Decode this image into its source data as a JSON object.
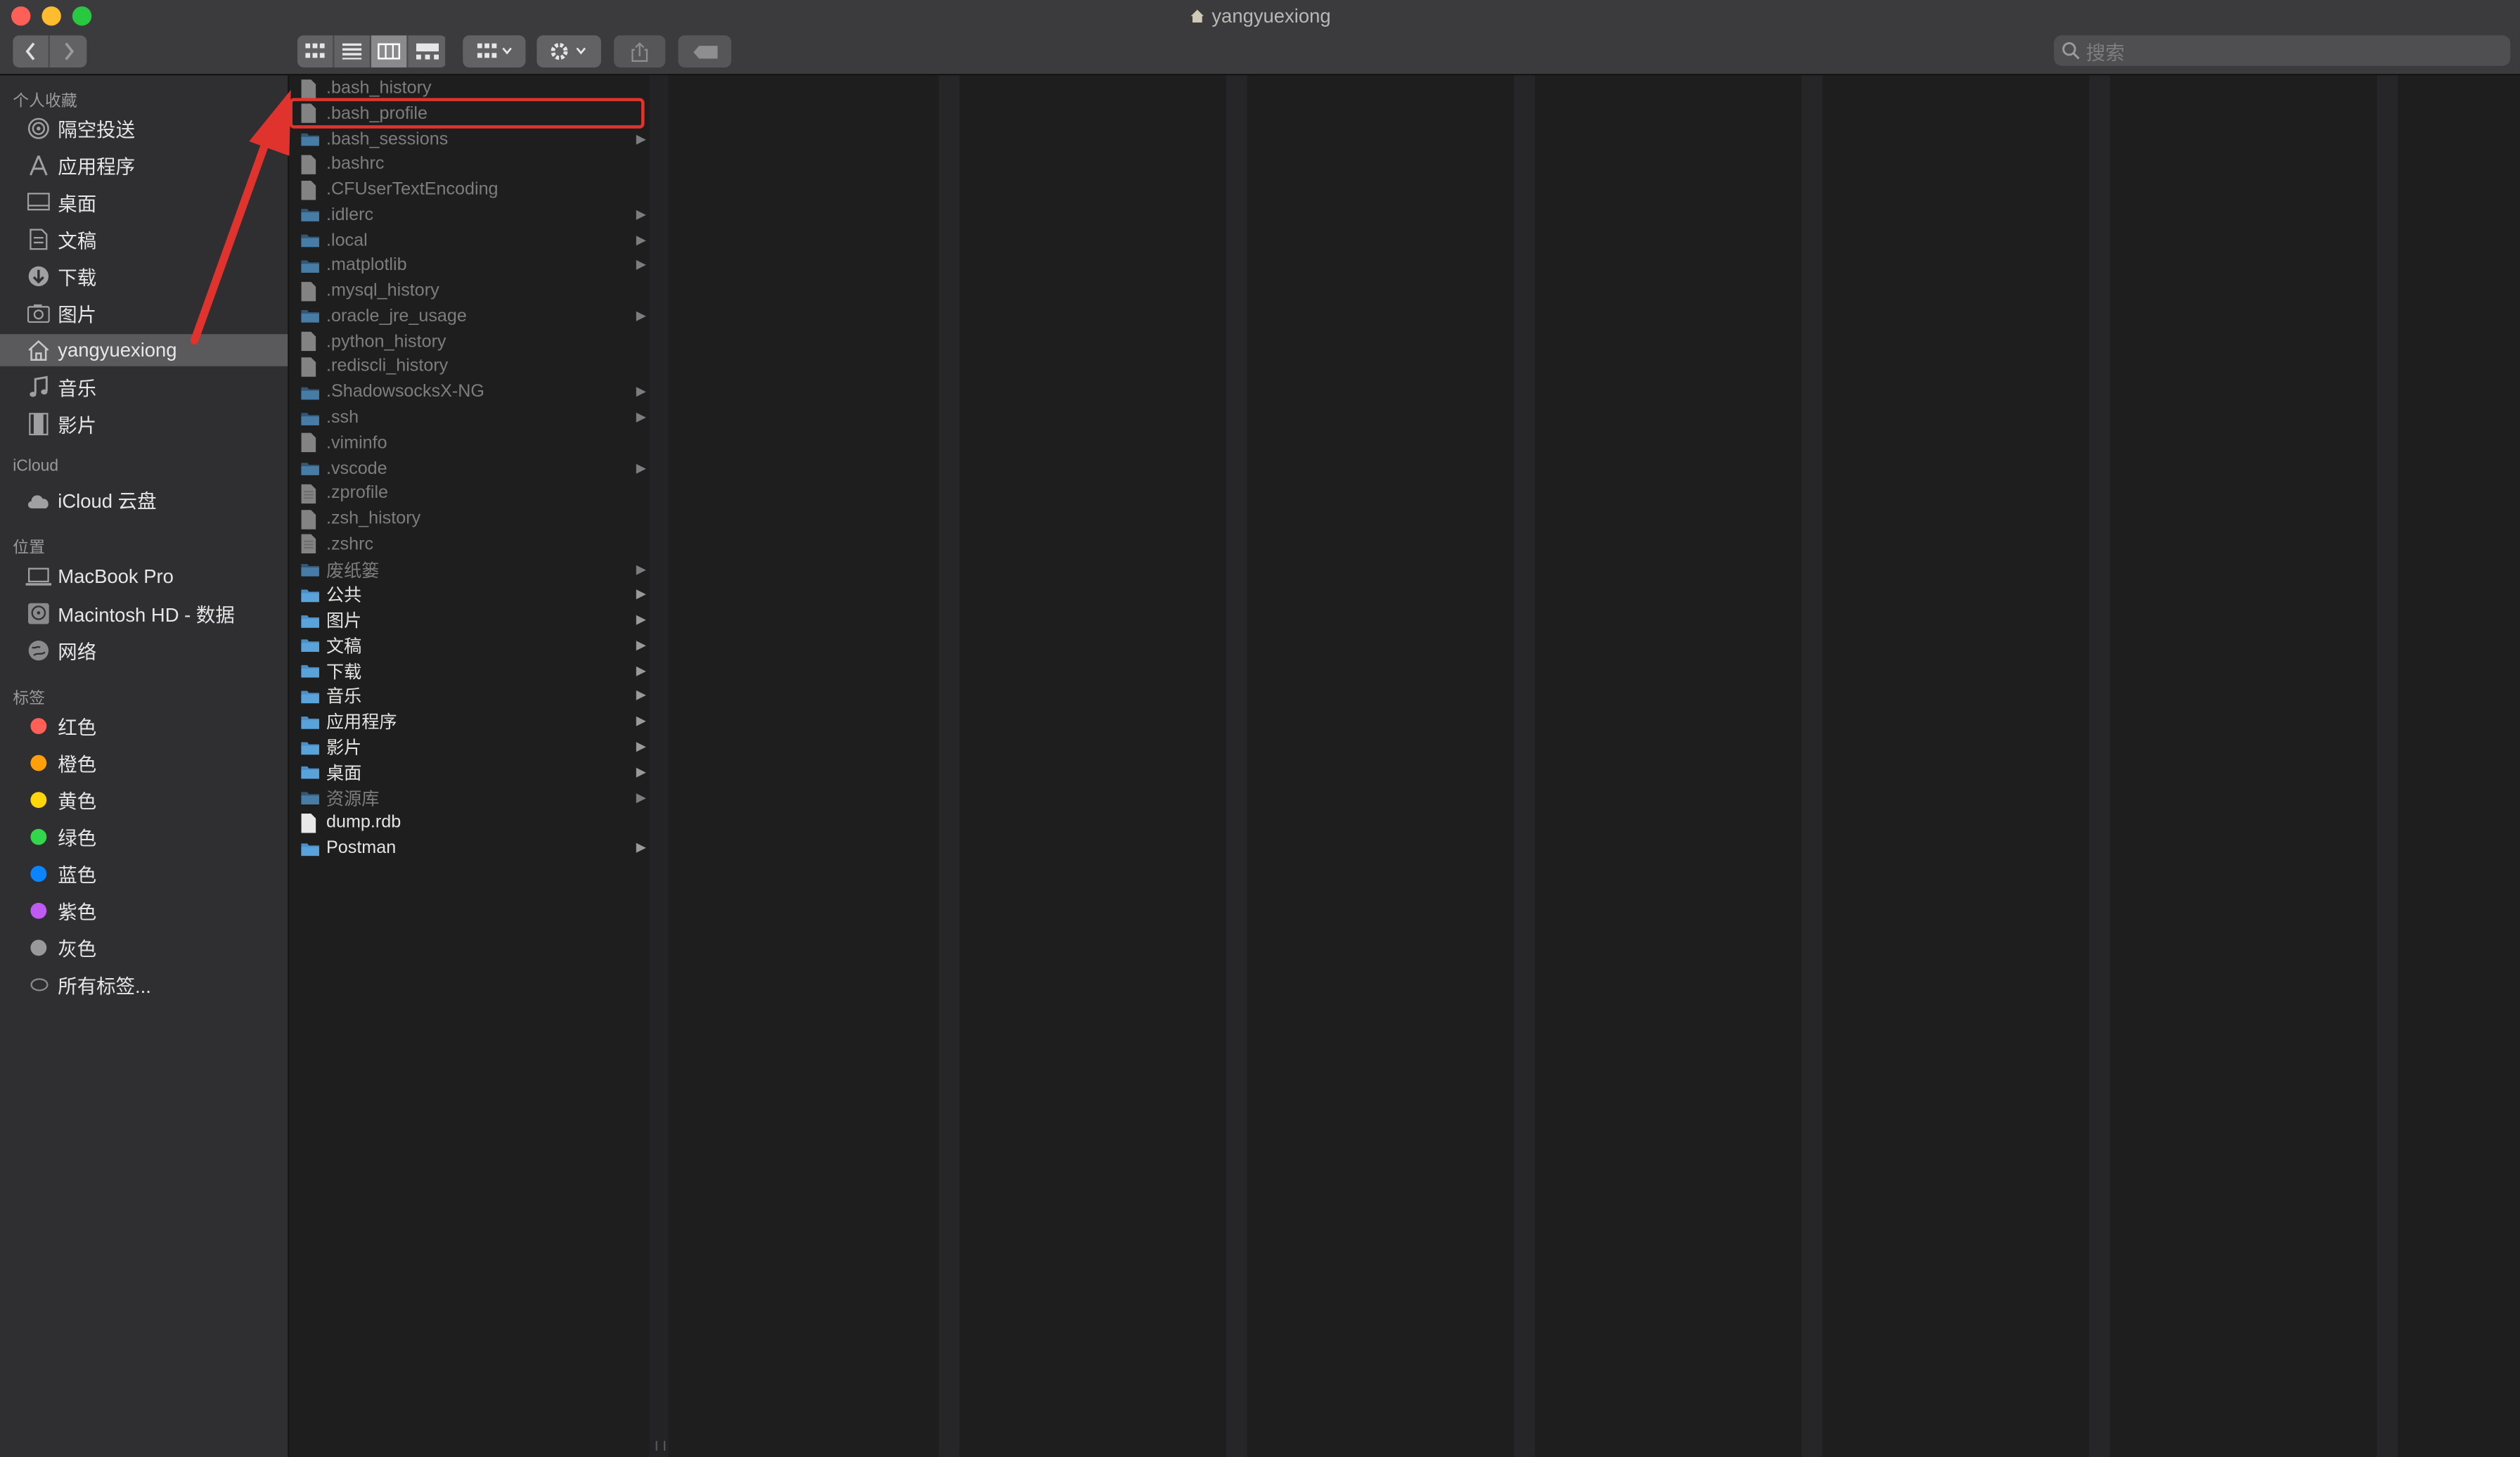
{
  "window": {
    "title": "yangyuexiong"
  },
  "toolbar": {
    "back": "chevron-left-icon",
    "forward": "chevron-right-icon",
    "views": [
      "icon-view-icon",
      "list-view-icon",
      "column-view-icon",
      "gallery-view-icon"
    ],
    "group": "group-by-icon",
    "action": "gear-icon",
    "share": "share-icon",
    "tag": "tag-icon",
    "search_placeholder": "搜索"
  },
  "sidebar": {
    "favorites_header": "个人收藏",
    "favorites": [
      {
        "label": "隔空投送",
        "icon": "airdrop-icon"
      },
      {
        "label": "应用程序",
        "icon": "applications-icon"
      },
      {
        "label": "桌面",
        "icon": "desktop-icon"
      },
      {
        "label": "文稿",
        "icon": "documents-icon"
      },
      {
        "label": "下载",
        "icon": "downloads-icon"
      },
      {
        "label": "图片",
        "icon": "pictures-icon"
      },
      {
        "label": "yangyuexiong",
        "icon": "home-icon",
        "selected": true
      },
      {
        "label": "音乐",
        "icon": "music-icon"
      },
      {
        "label": "影片",
        "icon": "movies-icon"
      }
    ],
    "icloud_header": "iCloud",
    "icloud": [
      {
        "label": "iCloud 云盘",
        "icon": "icloud-icon"
      }
    ],
    "locations_header": "位置",
    "locations": [
      {
        "label": "MacBook Pro",
        "icon": "laptop-icon"
      },
      {
        "label": "Macintosh HD - 数据",
        "icon": "disk-icon"
      },
      {
        "label": "网络",
        "icon": "network-icon"
      }
    ],
    "tags_header": "标签",
    "tags": [
      {
        "label": "红色",
        "color": "#ff5f57"
      },
      {
        "label": "橙色",
        "color": "#ff9f0a"
      },
      {
        "label": "黄色",
        "color": "#ffd60a"
      },
      {
        "label": "绿色",
        "color": "#32d74b"
      },
      {
        "label": "蓝色",
        "color": "#0a84ff"
      },
      {
        "label": "紫色",
        "color": "#bf5af2"
      },
      {
        "label": "灰色",
        "color": "#98989d"
      },
      {
        "label": "所有标签...",
        "color": "all"
      }
    ]
  },
  "files": [
    {
      "name": ".bash_history",
      "type": "file",
      "hidden": true
    },
    {
      "name": ".bash_profile",
      "type": "file",
      "hidden": true,
      "highlighted": true
    },
    {
      "name": ".bash_sessions",
      "type": "folder",
      "hidden": true
    },
    {
      "name": ".bashrc",
      "type": "file",
      "hidden": true
    },
    {
      "name": ".CFUserTextEncoding",
      "type": "file",
      "hidden": true
    },
    {
      "name": ".idlerc",
      "type": "folder",
      "hidden": true
    },
    {
      "name": ".local",
      "type": "folder",
      "hidden": true
    },
    {
      "name": ".matplotlib",
      "type": "folder",
      "hidden": true
    },
    {
      "name": ".mysql_history",
      "type": "file",
      "hidden": true
    },
    {
      "name": ".oracle_jre_usage",
      "type": "folder",
      "hidden": true
    },
    {
      "name": ".python_history",
      "type": "file",
      "hidden": true
    },
    {
      "name": ".rediscli_history",
      "type": "file",
      "hidden": true
    },
    {
      "name": ".ShadowsocksX-NG",
      "type": "folder",
      "hidden": true
    },
    {
      "name": ".ssh",
      "type": "folder",
      "hidden": true
    },
    {
      "name": ".viminfo",
      "type": "file",
      "hidden": true
    },
    {
      "name": ".vscode",
      "type": "folder",
      "hidden": true
    },
    {
      "name": ".zprofile",
      "type": "doc",
      "hidden": true
    },
    {
      "name": ".zsh_history",
      "type": "file",
      "hidden": true
    },
    {
      "name": ".zshrc",
      "type": "doc",
      "hidden": true
    },
    {
      "name": "废纸篓",
      "type": "folder",
      "hidden": true
    },
    {
      "name": "公共",
      "type": "folder",
      "hidden": false
    },
    {
      "name": "图片",
      "type": "folder",
      "hidden": false
    },
    {
      "name": "文稿",
      "type": "folder",
      "hidden": false
    },
    {
      "name": "下载",
      "type": "folder",
      "hidden": false
    },
    {
      "name": "音乐",
      "type": "folder",
      "hidden": false
    },
    {
      "name": "应用程序",
      "type": "folder",
      "hidden": false
    },
    {
      "name": "影片",
      "type": "folder",
      "hidden": false
    },
    {
      "name": "桌面",
      "type": "folder",
      "hidden": false
    },
    {
      "name": "资源库",
      "type": "folder",
      "hidden": true
    },
    {
      "name": "dump.rdb",
      "type": "file",
      "hidden": false
    },
    {
      "name": "Postman",
      "type": "folder",
      "hidden": false
    }
  ],
  "annotation": {
    "arrow_color": "#e0332d",
    "box_color": "#e0332d"
  }
}
